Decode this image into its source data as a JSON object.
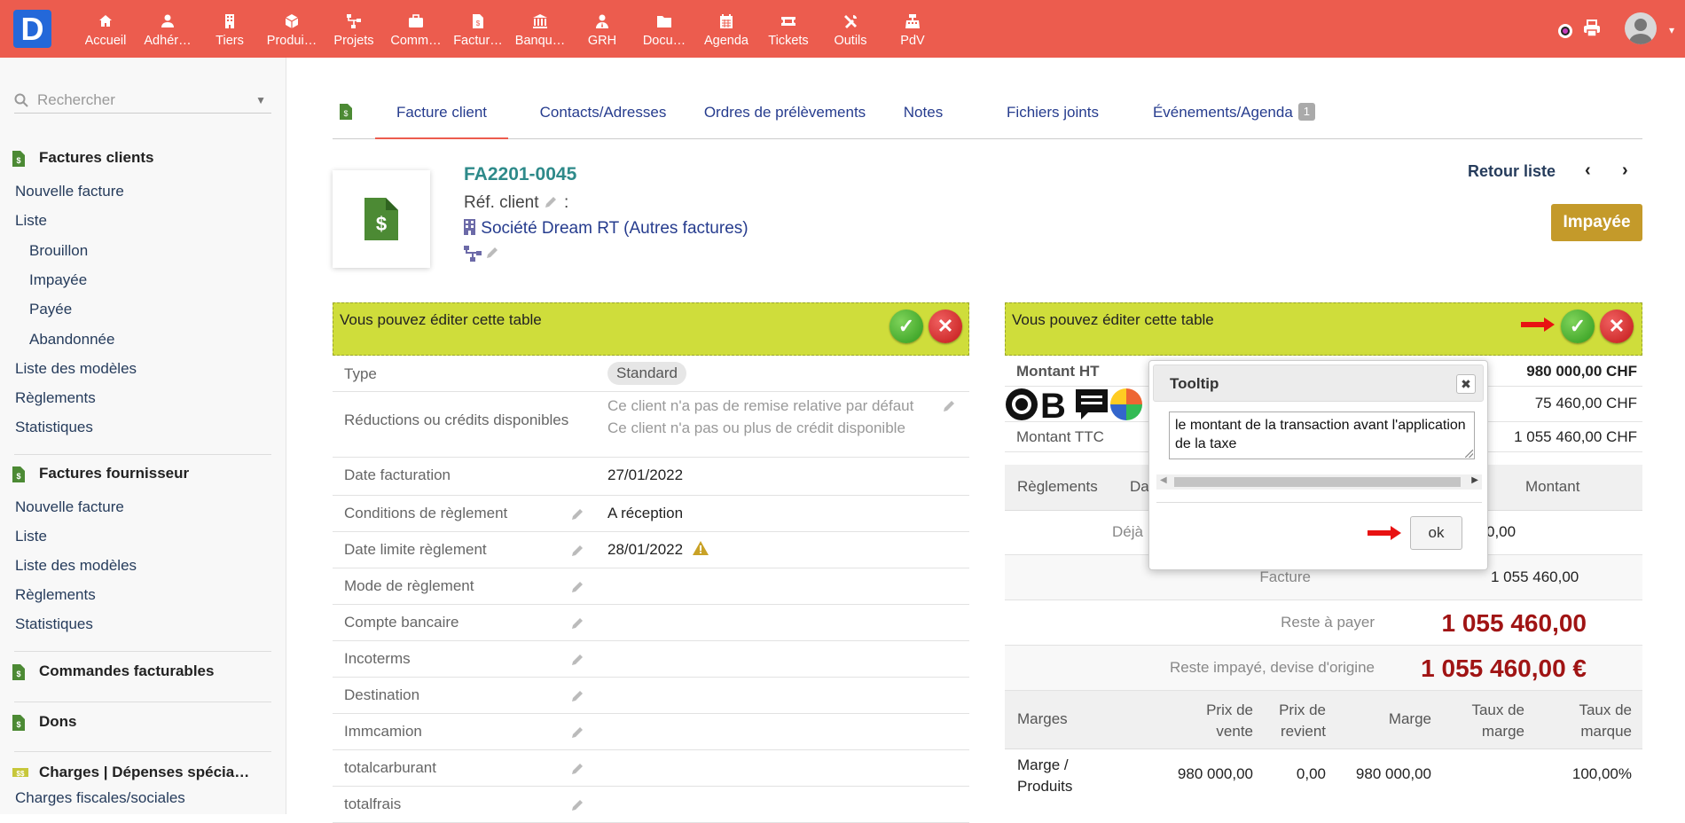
{
  "app": {
    "logo_letter": "D",
    "brand_color": "#ec5c4e"
  },
  "topmenu": [
    {
      "label": "Accueil",
      "icon": "home-icon"
    },
    {
      "label": "Adhér…",
      "icon": "user-icon"
    },
    {
      "label": "Tiers",
      "icon": "building-icon"
    },
    {
      "label": "Produi…",
      "icon": "cube-icon"
    },
    {
      "label": "Projets",
      "icon": "sitemap-icon"
    },
    {
      "label": "Comm…",
      "icon": "briefcase-icon"
    },
    {
      "label": "Factur…",
      "icon": "invoice-icon"
    },
    {
      "label": "Banqu…",
      "icon": "bank-icon"
    },
    {
      "label": "GRH",
      "icon": "user-tie-icon"
    },
    {
      "label": "Docu…",
      "icon": "folder-icon"
    },
    {
      "label": "Agenda",
      "icon": "calendar-icon"
    },
    {
      "label": "Tickets",
      "icon": "ticket-icon"
    },
    {
      "label": "Outils",
      "icon": "tools-icon"
    },
    {
      "label": "PdV",
      "icon": "cash-register-icon"
    }
  ],
  "sidebar": {
    "search_placeholder": "Rechercher",
    "sections": [
      {
        "title": "Factures clients",
        "items": [
          "Nouvelle facture",
          "Liste",
          "Brouillon",
          "Impayée",
          "Payée",
          "Abandonnée",
          "Liste des modèles",
          "Règlements",
          "Statistiques"
        ]
      },
      {
        "title": "Factures fournisseur",
        "items": [
          "Nouvelle facture",
          "Liste",
          "Liste des modèles",
          "Règlements",
          "Statistiques"
        ]
      },
      {
        "title": "Commandes facturables",
        "items": []
      },
      {
        "title": "Dons",
        "items": []
      },
      {
        "title": "Charges | Dépenses spécia…",
        "items": [
          "Charges fiscales/sociales"
        ]
      }
    ]
  },
  "tabs": [
    {
      "label": "Facture client"
    },
    {
      "label": "Contacts/Adresses"
    },
    {
      "label": "Ordres de prélèvements"
    },
    {
      "label": "Notes"
    },
    {
      "label": "Fichiers joints"
    },
    {
      "label": "Événements/Agenda",
      "badge": "1"
    }
  ],
  "invoice": {
    "ref": "FA2201-0045",
    "ref_client_label": "Réf. client",
    "ref_client_colon": ":",
    "company": "Société Dream RT",
    "category": "(Autres factures)",
    "back_label": "Retour liste",
    "status": "Impayée",
    "status_color": "#c49a2a"
  },
  "left_table": {
    "banner": "Vous pouvez éditer cette table",
    "rows": [
      {
        "label": "Type",
        "value": "Standard"
      },
      {
        "label": "Réductions ou crédits disponibles",
        "value": "Ce client n'a pas de remise relative par défaut",
        "value2": "Ce client n'a pas ou plus de crédit disponible"
      },
      {
        "label": "Date facturation",
        "value": "27/01/2022"
      },
      {
        "label": "Conditions de règlement",
        "value": "A réception"
      },
      {
        "label": "Date limite règlement",
        "value": "28/01/2022"
      },
      {
        "label": "Mode de règlement",
        "value": ""
      },
      {
        "label": "Compte bancaire",
        "value": ""
      },
      {
        "label": "Incoterms",
        "value": ""
      },
      {
        "label": "Destination",
        "value": ""
      },
      {
        "label": "Immcamion",
        "value": ""
      },
      {
        "label": "totalcarburant",
        "value": ""
      },
      {
        "label": "totalfrais",
        "value": ""
      }
    ]
  },
  "right_table": {
    "banner": "Vous pouvez éditer cette table",
    "montant_ht_label": "Montant HT",
    "montant_ht": "980 000,00 CHF",
    "montant_tva": "75 460,00 CHF",
    "montant_ttc_label": "Montant TTC",
    "montant_ttc": "1 055 460,00 CHF",
    "reglements_header": {
      "col1": "Règlements",
      "col2": "Da",
      "col3": "Montant"
    },
    "deja_label": "Déjà",
    "deja_value": "0,00",
    "facture_label": "Facture",
    "facture_value": "1 055 460,00",
    "reste_label": "Reste à payer",
    "reste_value": "1 055 460,00",
    "reste_orig_label": "Reste impayé, devise d'origine",
    "reste_orig_value": "1 055 460,00 €",
    "marges_header": [
      "Marges",
      "Prix de vente",
      "Prix de revient",
      "Marge",
      "Taux de marge",
      "Taux de marque"
    ],
    "marges_row": [
      "Marge / Produits",
      "980 000,00",
      "0,00",
      "980 000,00",
      "",
      "100,00%"
    ]
  },
  "tooltip": {
    "title": "Tooltip",
    "text": "le montant de la transaction avant l'application de la taxe",
    "ok_label": "ok"
  }
}
